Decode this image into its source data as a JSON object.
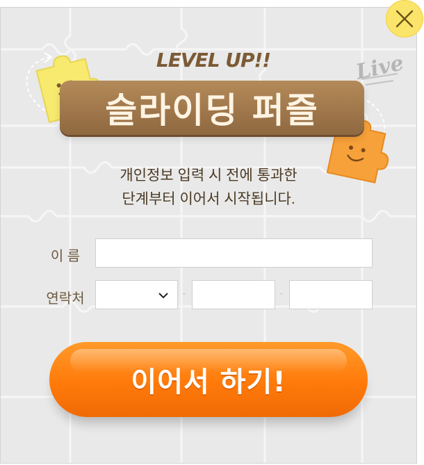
{
  "popup": {
    "level_up": "LEVEL UP!!",
    "live_tag": "Live",
    "title": "슬라이딩 퍼즐",
    "description": [
      "개인정보 입력 시 전에  통과한",
      "단계부터 이어서 시작됩니다."
    ]
  },
  "form": {
    "name_label": "이  름",
    "name_value": "",
    "name_placeholder": "",
    "phone_label": "연락처",
    "phone_prefix_value": "",
    "phone_mid_value": "",
    "phone_last_value": "",
    "separator": "-"
  },
  "submit": {
    "label": "이어서 하기!"
  },
  "colors": {
    "close_bg": "#fbe46a",
    "title_plate": "#a27a4d",
    "submit_orange": "#ff7f0f",
    "puzzle_yellow": "#f7ea6f",
    "puzzle_orange": "#f7a13a"
  },
  "icons": [
    "close-icon",
    "chevron-down-icon",
    "puzzle-piece-yellow-icon",
    "puzzle-piece-orange-icon"
  ]
}
